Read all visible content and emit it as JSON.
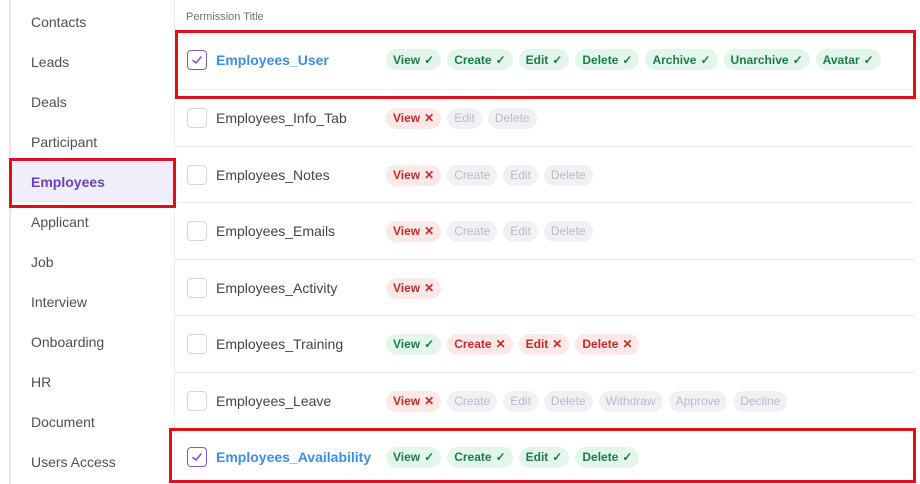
{
  "sidebar": {
    "items": [
      {
        "label": "Contacts"
      },
      {
        "label": "Leads"
      },
      {
        "label": "Deals"
      },
      {
        "label": "Participant"
      },
      {
        "label": "Employees"
      },
      {
        "label": "Applicant"
      },
      {
        "label": "Job"
      },
      {
        "label": "Interview"
      },
      {
        "label": "Onboarding"
      },
      {
        "label": "HR"
      },
      {
        "label": "Document"
      },
      {
        "label": "Users Access"
      }
    ],
    "active": "Employees"
  },
  "table": {
    "header": "Permission Title",
    "rows": [
      {
        "title": "Employees_User",
        "checked": true,
        "chips": [
          {
            "label": "View",
            "state": "granted"
          },
          {
            "label": "Create",
            "state": "granted"
          },
          {
            "label": "Edit",
            "state": "granted"
          },
          {
            "label": "Delete",
            "state": "granted"
          },
          {
            "label": "Archive",
            "state": "granted"
          },
          {
            "label": "Unarchive",
            "state": "granted"
          },
          {
            "label": "Avatar",
            "state": "granted"
          }
        ]
      },
      {
        "title": "Employees_Info_Tab",
        "checked": false,
        "chips": [
          {
            "label": "View",
            "state": "denied"
          },
          {
            "label": "Edit",
            "state": "disabled"
          },
          {
            "label": "Delete",
            "state": "disabled"
          }
        ]
      },
      {
        "title": "Employees_Notes",
        "checked": false,
        "chips": [
          {
            "label": "View",
            "state": "denied"
          },
          {
            "label": "Create",
            "state": "disabled"
          },
          {
            "label": "Edit",
            "state": "disabled"
          },
          {
            "label": "Delete",
            "state": "disabled"
          }
        ]
      },
      {
        "title": "Employees_Emails",
        "checked": false,
        "chips": [
          {
            "label": "View",
            "state": "denied"
          },
          {
            "label": "Create",
            "state": "disabled"
          },
          {
            "label": "Edit",
            "state": "disabled"
          },
          {
            "label": "Delete",
            "state": "disabled"
          }
        ]
      },
      {
        "title": "Employees_Activity",
        "checked": false,
        "chips": [
          {
            "label": "View",
            "state": "denied"
          }
        ]
      },
      {
        "title": "Employees_Training",
        "checked": false,
        "chips": [
          {
            "label": "View",
            "state": "granted"
          },
          {
            "label": "Create",
            "state": "denied"
          },
          {
            "label": "Edit",
            "state": "denied"
          },
          {
            "label": "Delete",
            "state": "denied"
          }
        ]
      },
      {
        "title": "Employees_Leave",
        "checked": false,
        "chips": [
          {
            "label": "View",
            "state": "denied"
          },
          {
            "label": "Create",
            "state": "disabled"
          },
          {
            "label": "Edit",
            "state": "disabled"
          },
          {
            "label": "Delete",
            "state": "disabled"
          },
          {
            "label": "Withdraw",
            "state": "disabled"
          },
          {
            "label": "Approve",
            "state": "disabled"
          },
          {
            "label": "Decline",
            "state": "disabled"
          }
        ]
      },
      {
        "title": "Employees_Availability",
        "checked": true,
        "chips": [
          {
            "label": "View",
            "state": "granted"
          },
          {
            "label": "Create",
            "state": "granted"
          },
          {
            "label": "Edit",
            "state": "granted"
          },
          {
            "label": "Delete",
            "state": "granted"
          }
        ]
      }
    ]
  },
  "highlight_color": "#e10f17",
  "accent_color": "#6b3fc4"
}
